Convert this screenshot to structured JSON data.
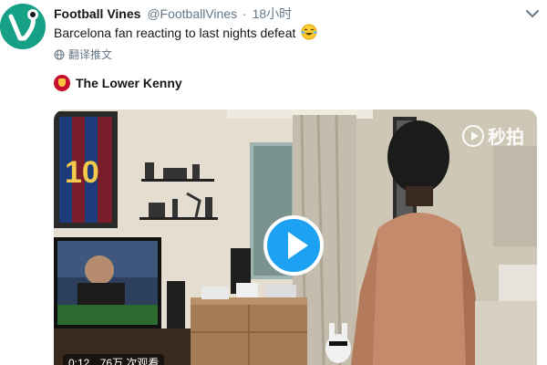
{
  "tweet": {
    "author_name": "Football Vines",
    "author_handle": "@FootballVines",
    "separator": "·",
    "time_ago": "18小时",
    "text": "Barcelona fan reacting to last nights defeat",
    "text_emoji": "face-with-tears-of-joy",
    "translate_label": "翻译推文",
    "attribution": "The Lower Kenny"
  },
  "video": {
    "watermark": "秒拍",
    "elapsed": "0:12",
    "views": "76万 次观看"
  },
  "colors": {
    "accent": "#1da1f2",
    "name": "#14171a",
    "secondary": "#657786",
    "avatar_bg": "#16a085",
    "attribution_badge": "#c8102e"
  },
  "icons": {
    "caret": "chevron-down-icon",
    "translate": "globe-icon",
    "play": "play-icon",
    "watermark": "miaopai-logo-icon"
  }
}
